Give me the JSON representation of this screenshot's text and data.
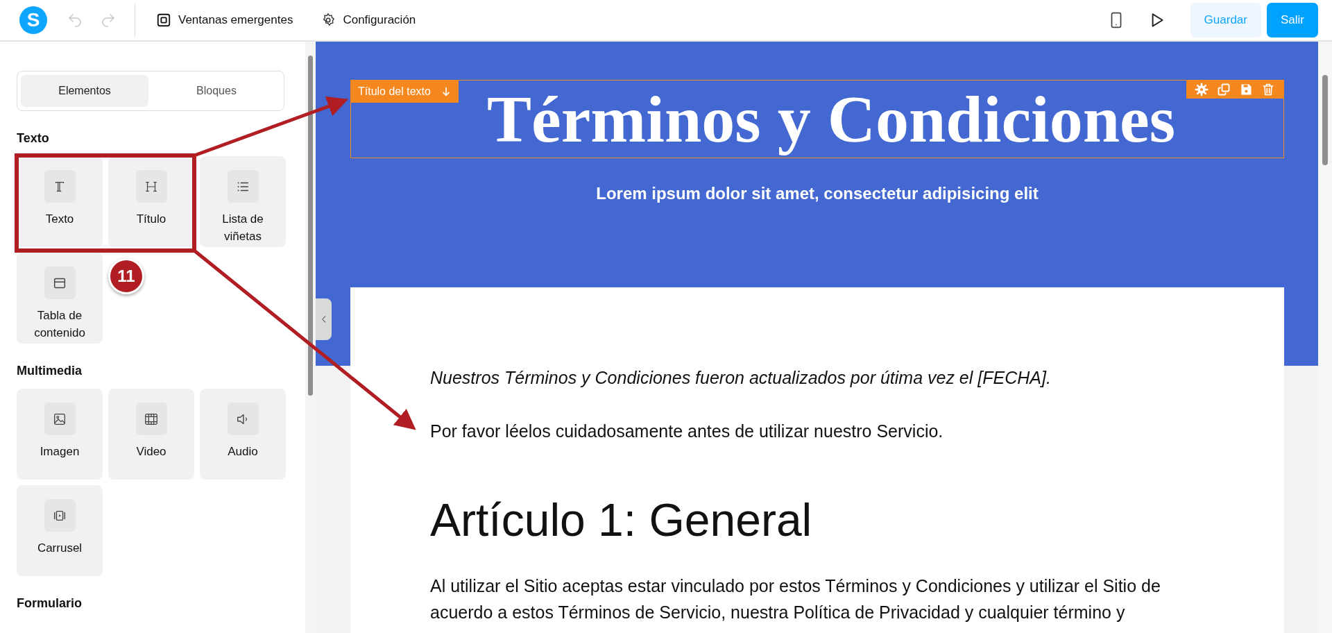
{
  "topbar": {
    "logo": "S",
    "undo": {
      "disabled": true
    },
    "redo": {
      "disabled": true
    },
    "menu": [
      {
        "label": "Ventanas emergentes"
      },
      {
        "label": "Configuración"
      }
    ],
    "buttons": [
      {
        "label": "Guardar",
        "kind": "secondary"
      },
      {
        "label": "Salir",
        "kind": "primary"
      }
    ]
  },
  "sidebar": {
    "tabs": [
      {
        "label": "Elementos",
        "selected": true
      },
      {
        "label": "Bloques",
        "selected": false
      }
    ],
    "sections": [
      {
        "title": "Texto",
        "items": [
          {
            "label": "Texto"
          },
          {
            "label": "Título"
          },
          {
            "label": "Lista de viñetas"
          },
          {
            "label": "Tabla de contenido"
          }
        ]
      },
      {
        "title": "Multimedia",
        "items": [
          {
            "label": "Imagen"
          },
          {
            "label": "Video"
          },
          {
            "label": "Audio"
          },
          {
            "label": "Carrusel"
          }
        ]
      },
      {
        "title": "Formulario"
      }
    ]
  },
  "canvas": {
    "selected_label": "Título del texto",
    "title": "Términos y Condiciones",
    "subtitle": "Lorem ipsum dolor sit amet, consectetur adipisicing elit",
    "content": [
      {
        "kind": "note",
        "text": "Nuestros Términos y Condiciones fueron actualizados por útima vez el [FECHA]."
      },
      {
        "kind": "paragraph",
        "text": "Por favor léelos cuidadosamente antes de utilizar nuestro Servicio."
      },
      {
        "kind": "heading",
        "text": "Artículo 1: General"
      },
      {
        "kind": "paragraph",
        "text": "Al utilizar el Sitio aceptas estar vinculado por estos Términos y Condiciones y utilizar el Sitio de acuerdo a estos Términos de Servicio, nuestra Política de Privacidad y cualquier término y"
      }
    ]
  },
  "annotation": {
    "step": "11"
  }
}
